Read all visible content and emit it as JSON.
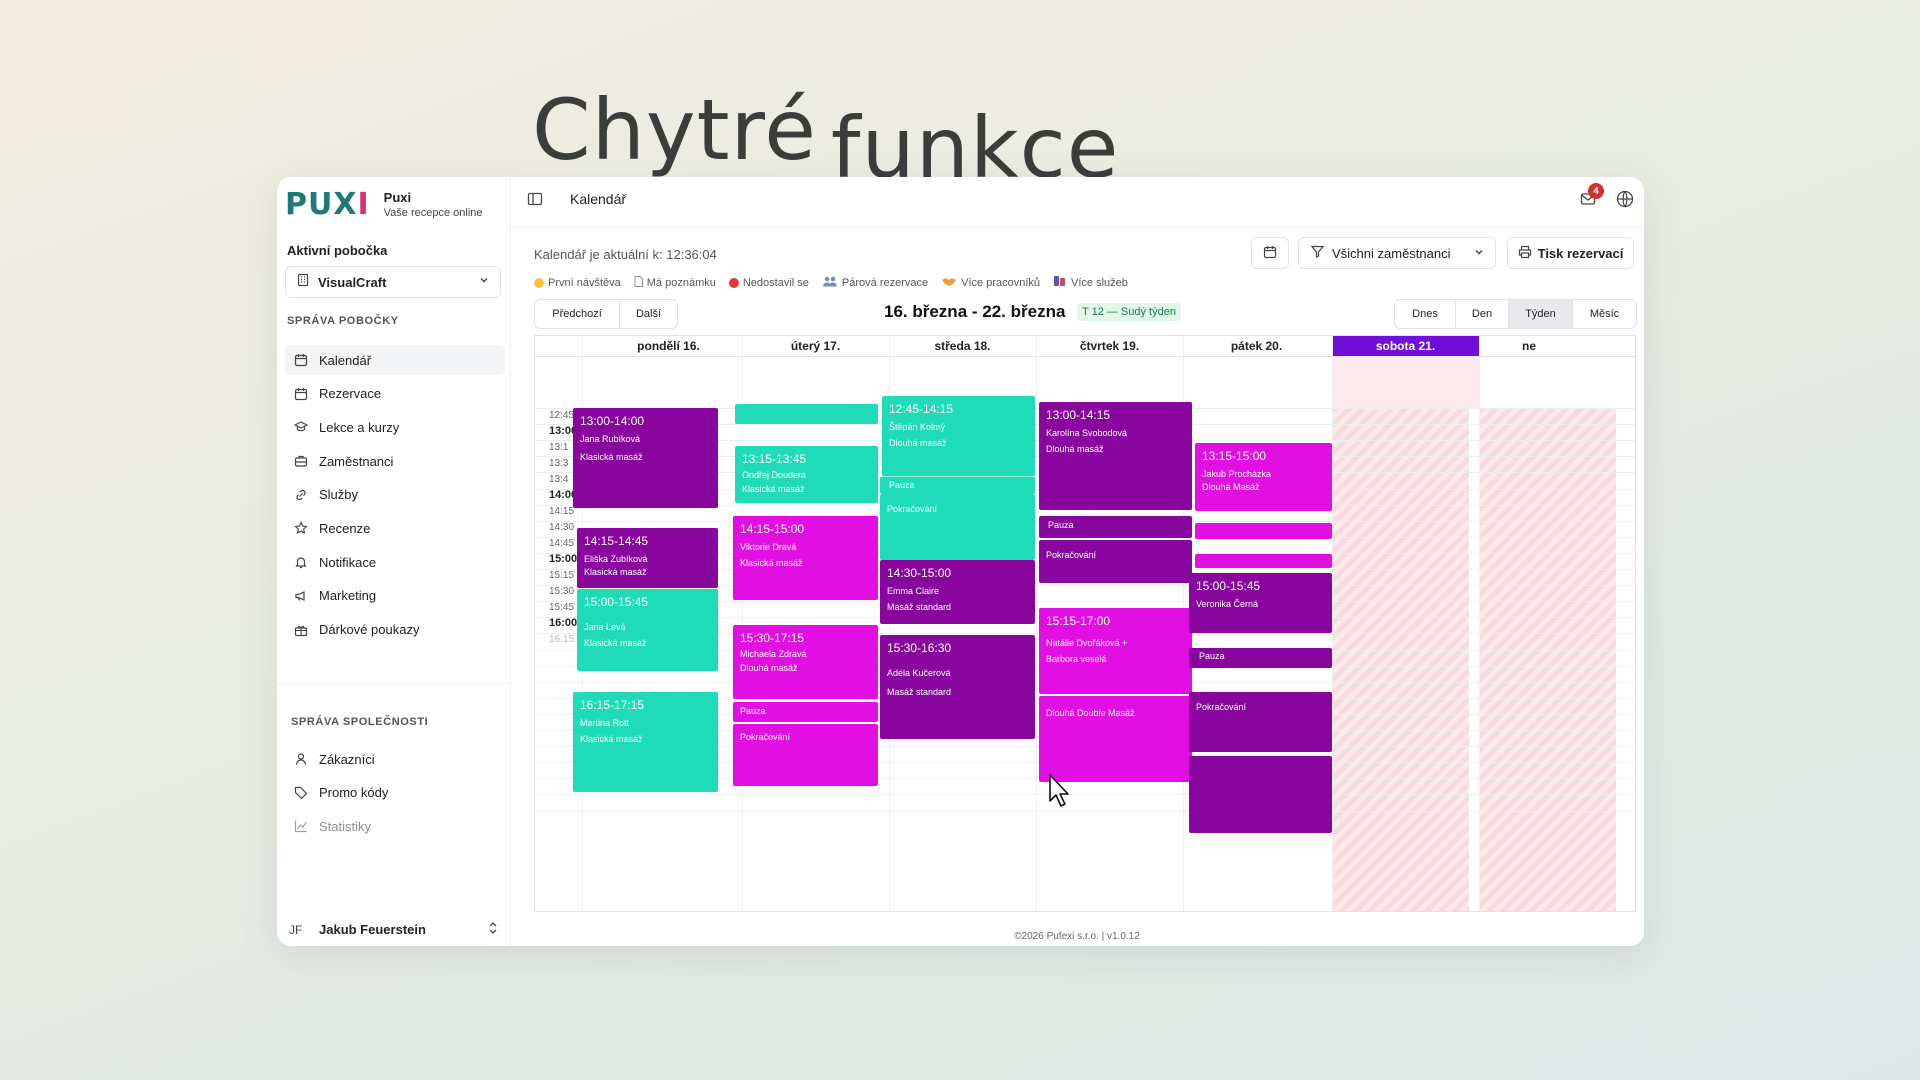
{
  "hero": {
    "word1": "Chytré",
    "word2": "funkce"
  },
  "brand": {
    "logo": "PUX",
    "logo_x": "I",
    "name": "Puxi",
    "tagline": "Vaše recepce online"
  },
  "sidebar": {
    "branch_label": "Aktivní pobočka",
    "branch_value": "VisualCraft",
    "section1": "SPRÁVA POBOČKY",
    "items1": [
      {
        "label": "Kalendář",
        "icon": "calendar-icon"
      },
      {
        "label": "Rezervace",
        "icon": "calendar-check-icon"
      },
      {
        "label": "Lekce a kurzy",
        "icon": "graduation-cap-icon"
      },
      {
        "label": "Zaměstnanci",
        "icon": "briefcase-icon"
      },
      {
        "label": "Služby",
        "icon": "link-icon"
      },
      {
        "label": "Recenze",
        "icon": "star-icon"
      },
      {
        "label": "Notifikace",
        "icon": "bell-icon"
      },
      {
        "label": "Marketing",
        "icon": "megaphone-icon"
      },
      {
        "label": "Dárkové poukazy",
        "icon": "gift-icon"
      }
    ],
    "section2": "SPRÁVA SPOLEČNOSTI",
    "items2": [
      {
        "label": "Zákazníci",
        "icon": "user-icon"
      },
      {
        "label": "Promo kódy",
        "icon": "tag-icon"
      },
      {
        "label": "Statistiky",
        "icon": "chart-icon"
      }
    ],
    "user_initials": "JF",
    "user_name": "Jakub Feuerstein"
  },
  "header": {
    "title": "Kalendář",
    "notification_count": "4"
  },
  "toolbar": {
    "updated": "Kalendář je aktuální k: 12:36:04",
    "employees": "Všichni zaměstnanci",
    "print": "Tisk rezervací",
    "prev": "Předchozí",
    "next": "Další",
    "range": "16. března - 22. března",
    "week": "T 12 — Sudý týden",
    "views": [
      "Dnes",
      "Den",
      "Týden",
      "Měsíc"
    ],
    "active_view": "Týden"
  },
  "legend": [
    {
      "label": "První návštěva",
      "color": "#f5c542"
    },
    {
      "label": "Má poznámku",
      "color": "#b0b6bd"
    },
    {
      "label": "Nedostavil se",
      "color": "#e53935"
    },
    {
      "label": "Párová rezervace",
      "color": "#7a8fa6"
    },
    {
      "label": "Více pracovníků",
      "color": "#e8a23a"
    },
    {
      "label": "Více služeb",
      "color": "#6b4fa0"
    }
  ],
  "days": [
    "pondělí 16.",
    "úterý 17.",
    "středa 18.",
    "čtvrtek 19.",
    "pátek 20.",
    "sobota 21.",
    "ne"
  ],
  "times": [
    "12:45",
    "13:00",
    "13:1",
    "13:3",
    "13:4",
    "14:00",
    "14:15",
    "14:30",
    "14:45",
    "15:00",
    "15:15",
    "15:30",
    "15:45",
    "16:00",
    "16:15"
  ],
  "events": [
    {
      "time": "",
      "line1": "",
      "line2": "",
      "color": "#20dbb7"
    },
    {
      "time": "13:00-14:00",
      "line1": "Jana Rubíková",
      "line2": "Klasická masáž",
      "color": "#88069e"
    },
    {
      "time": "14:15-14:45",
      "line1": "Eliška Zubíková",
      "line2": "Klasická masáž",
      "color": "#88069e"
    },
    {
      "time": "15:00-15:45",
      "line1": "Jana Levá",
      "line2": "Klasická masáž",
      "color": "#20dbb7"
    },
    {
      "time": "16:15-17:15",
      "line1": "Martina Rott",
      "line2": "Klasická masáž",
      "color": "#20dbb7"
    },
    {
      "time": "13:15-13:45",
      "line1": "Ondřej Doudera",
      "line2": "Klasická masáž",
      "color": "#20dbb7"
    },
    {
      "time": "14:15-15:00",
      "line1": "Viktorie Dravá",
      "line2": "Klasická masáž",
      "color": "#e20fe2"
    },
    {
      "time": "15:30-17:15",
      "line1": "Michaela Zdravá",
      "line2": "Dlouhá masáž",
      "color": "#e20fe2"
    },
    {
      "time": "",
      "line1": "Pauza",
      "line2": "",
      "color": "#e20fe2"
    },
    {
      "time": "",
      "line1": "Pokračování",
      "line2": "",
      "color": "#e20fe2"
    },
    {
      "time": "12:45-14:15",
      "line1": "Štěpán Kolmý",
      "line2": "Dlouhá masáž",
      "color": "#20dbb7"
    },
    {
      "time": "",
      "line1": "Pauza",
      "line2": "",
      "color": "#20dbb7"
    },
    {
      "time": "",
      "line1": "Pokračování",
      "line2": "",
      "color": "#20dbb7"
    },
    {
      "time": "14:30-15:00",
      "line1": "Emma Claire",
      "line2": "Masáž standard",
      "color": "#88069e"
    },
    {
      "time": "15:30-16:30",
      "line1": "Adéla Kučerová",
      "line2": "Masáž standard",
      "color": "#88069e"
    },
    {
      "time": "13:00-14:15",
      "line1": "Karolína Svobodová",
      "line2": "Dlouhá masáž",
      "color": "#88069e"
    },
    {
      "time": "",
      "line1": "Pauza",
      "line2": "",
      "color": "#88069e"
    },
    {
      "time": "",
      "line1": "Pokračování",
      "line2": "",
      "color": "#88069e"
    },
    {
      "time": "15:15-17:00",
      "line1": "Natálie Dvořáková +",
      "line2": "Barbora veselá",
      "color": "#e20fe2"
    },
    {
      "time": "",
      "line1": "Dlouhá Double Masáž",
      "line2": "",
      "color": "#e20fe2"
    },
    {
      "time": "13:15-15:00",
      "line1": "Jakub Procházka",
      "line2": "Dlouhá Masáž",
      "color": "#e20fe2"
    },
    {
      "time": "",
      "line1": "",
      "line2": "",
      "color": "#e20fe2"
    },
    {
      "time": "",
      "line1": "",
      "line2": "",
      "color": "#e20fe2"
    },
    {
      "time": "15:00-15:45",
      "line1": "Veronika Černá",
      "line2": "",
      "color": "#88069e"
    },
    {
      "time": "",
      "line1": "Pauza",
      "line2": "",
      "color": "#88069e"
    },
    {
      "time": "",
      "line1": "Pokračování",
      "line2": "",
      "color": "#88069e"
    },
    {
      "time": "",
      "line1": "",
      "line2": "",
      "color": "#88069e"
    }
  ],
  "footer": "©2026 Pufexi s.r.o.  |  v1.0.12"
}
